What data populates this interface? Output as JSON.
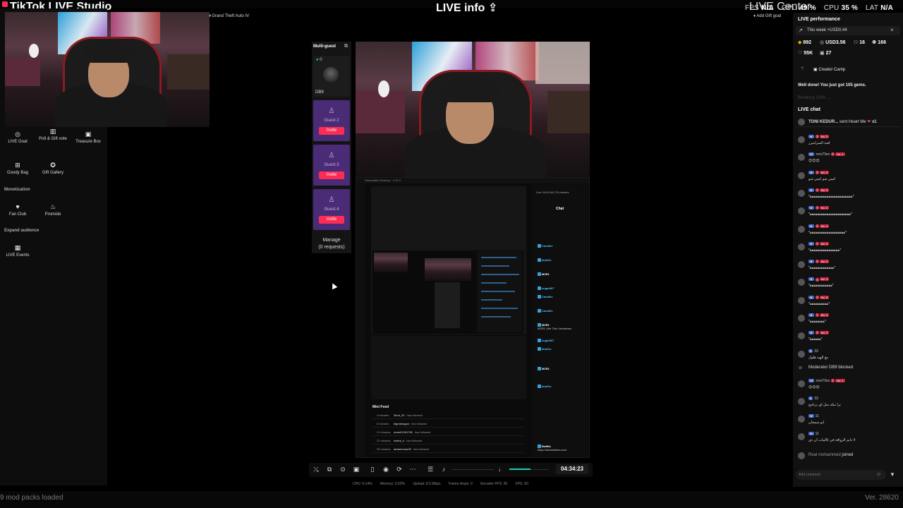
{
  "app": {
    "title": "TikTok LIVE Studio",
    "live_info": "LIVE info",
    "live_center": "LIVE Center",
    "game_tag": "Grand Theft Auto IV",
    "gift_goal": "Add Gift goal"
  },
  "stats": {
    "fps_label": "FPS",
    "fps_value": "N/A",
    "gpu_label": "GPU",
    "gpu_value": "49 %",
    "cpu_label": "CPU",
    "cpu_value": "35 %",
    "lat_label": "LAT",
    "lat_value": "N/A"
  },
  "left_tools": {
    "live_goal": "LIVE Goal",
    "poll": "Poll & Gift vote",
    "treasure": "Treasure Box",
    "goody": "Goody Bag",
    "gift_gallery": "Gift Gallery",
    "monetization": "Monetization",
    "fan_club": "Fan Club",
    "promote": "Promote",
    "expand": "Expand audience",
    "live_events": "LIVE Events"
  },
  "multiguest": {
    "title": "Multi-guest",
    "host_count": "0",
    "host_name": "DB9",
    "guests": [
      {
        "name": "Guest 2",
        "invite": "Invite"
      },
      {
        "name": "Guest 3",
        "invite": "Invite"
      },
      {
        "name": "Guest 4",
        "invite": "Invite"
      }
    ],
    "manage": "Manage",
    "requests": "(0 requests)"
  },
  "streamlabs": {
    "title": "Streamlabs Desktop - 1.20.0",
    "chat_header": "Live 04:03:08   278 viewers",
    "chat_title": "Chat",
    "chat_lines": [
      {
        "user": "Candiliz",
        "text": "",
        "color": "#4fc3f7"
      },
      {
        "user": "aisaf1c",
        "text": "",
        "color": "#4fc3f7"
      },
      {
        "user": "MZR1",
        "text": "",
        "color": "#ffffff"
      },
      {
        "user": "sugar867",
        "text": "",
        "color": "#4fc3f7"
      },
      {
        "user": "Candiliz",
        "text": "",
        "color": "#4fc3f7"
      },
      {
        "user": "Candiliz",
        "text": "",
        "color": "#4fc3f7"
      },
      {
        "user": "MZR1",
        "text": "MZR1 Like The Livestream",
        "color": "#ffffff"
      },
      {
        "user": "sugar867",
        "text": "",
        "color": "#4fc3f7"
      },
      {
        "user": "aisaf1c",
        "text": "",
        "color": "#4fc3f7"
      },
      {
        "user": "MZR1",
        "text": "",
        "color": "#ffffff"
      },
      {
        "user": "aisaf1c",
        "text": "",
        "color": "#4fc3f7"
      },
      {
        "user": "BotNic",
        "text": "https://streamlabs.com/",
        "color": "#ffffff"
      }
    ],
    "minifeed_title": "Mini Feed",
    "minifeed": [
      {
        "time": "4 minutes",
        "user": "3bod_92",
        "action": "has followed"
      },
      {
        "time": "6 minutes",
        "user": "bigmdeagon",
        "action": "has followed"
      },
      {
        "time": "21 minutes",
        "user": "omar91261782",
        "action": "has followed"
      },
      {
        "time": "21 minutes",
        "user": "hafeul_k",
        "action": "has followed"
      },
      {
        "time": "39 minutes",
        "user": "abdarhman28",
        "action": "has followed"
      }
    ]
  },
  "controls": {
    "timer": "04:34:23"
  },
  "perf": {
    "cpu": "CPU: 0.14%",
    "memory": "Memory: 0.52%",
    "upload": "Upload: 8.5 Mbps",
    "drops": "Frame drops: 0",
    "encoder": "Encoder FPS: 60",
    "fps": "FPS: 60"
  },
  "status": {
    "mods": "9 mod packs loaded",
    "version": "Ver. 28620"
  },
  "right": {
    "title": "LIVE performance",
    "week": "This week +USD0.44",
    "stats": {
      "gems": "892",
      "usd": "USD3.56",
      "viewers": "16",
      "likes_small": "166",
      "likes": "55K",
      "gifters": "27"
    },
    "creator_camp": "Creator Camp",
    "well_done": "Well done! You just got 105 gems.",
    "faded": "Breaking 1000 ...",
    "live_chat": "LIVE chat",
    "pinned_user": "TONI KEDUR...",
    "pinned_action": "sent Heart Me",
    "pinned_count": "x1",
    "chat": [
      {
        "lvl": "",
        "rank": "No. 3",
        "msg": "لعبة السراميرز"
      },
      {
        "lvl": "22",
        "name": "roro73xo",
        "rank": "No. 1",
        "msg": ""
      },
      {
        "lvl": "",
        "rank": "No. 3",
        "msg": "كيس شو كيس شو"
      },
      {
        "lvl": "",
        "rank": "No. 3",
        "msg": "*ﻫﻫﻫﻫﻫﻫﻫﻫﻫﻫﻫﻫﻫﻫﻫﻫﻫﻫﻫﻫﻫﻫﻫ*"
      },
      {
        "lvl": "",
        "rank": "No. 3",
        "msg": "*ﻫﻫﻫﻫﻫﻫﻫﻫﻫﻫﻫﻫﻫﻫﻫﻫﻫﻫﻫﻫﻫﻫ*"
      },
      {
        "lvl": "",
        "rank": "No. 3",
        "msg": "*ﻫﻫﻫﻫﻫﻫﻫﻫﻫﻫﻫﻫﻫﻫﻫﻫﻫﻫﻫ*"
      },
      {
        "lvl": "",
        "rank": "No. 3",
        "msg": "*ﻫﻫﻫﻫﻫﻫﻫﻫﻫﻫﻫﻫﻫﻫﻫﻫ*"
      },
      {
        "lvl": "",
        "rank": "No. 3",
        "msg": "*ﻫﻫﻫﻫﻫﻫﻫﻫﻫﻫﻫﻫﻫ*"
      },
      {
        "lvl": "",
        "rank": "No. 3",
        "msg": "*ﻫﻫﻫﻫﻫﻫﻫﻫﻫﻫﻫﻫ*"
      },
      {
        "lvl": "",
        "rank": "No. 3",
        "msg": "*ﻫﻫﻫﻫﻫﻫﻫﻫﻫﻫ*"
      },
      {
        "lvl": "",
        "rank": "No. 3",
        "msg": "*ﻫﻫﻫﻫﻫﻫﻫﻫ*"
      },
      {
        "lvl": "",
        "rank": "No. 3",
        "msg": "*ﻫﻫﻫﻫﻫﻫ*"
      },
      {
        "lvl": "8",
        "name": "33",
        "rank": "",
        "msg": "مع الهيه هلول"
      }
    ],
    "moderator": "Moderator DB9 blocked",
    "chat2": [
      {
        "lvl": "22",
        "name": "roro73xo",
        "rank": "No. 1",
        "msg": ""
      },
      {
        "lvl": "8",
        "name": "33",
        "rank": "",
        "msg": "ترا مثله متل اي برنامج"
      },
      {
        "lvl": "",
        "name": "11",
        "rank": "",
        "msg": "ابو سمحان"
      },
      {
        "lvl": "",
        "name": "11",
        "rank": "",
        "msg": "لا دايم الرواقة في كاليبات ان ذي"
      }
    ],
    "joined_user": "Real mohammed",
    "joined_text": "joined",
    "comment_placeholder": "Add comment"
  },
  "colors": {
    "accent": "#fe2c55",
    "guest_bg": "#4a2b76",
    "mic_level": "#1fd1b0"
  }
}
